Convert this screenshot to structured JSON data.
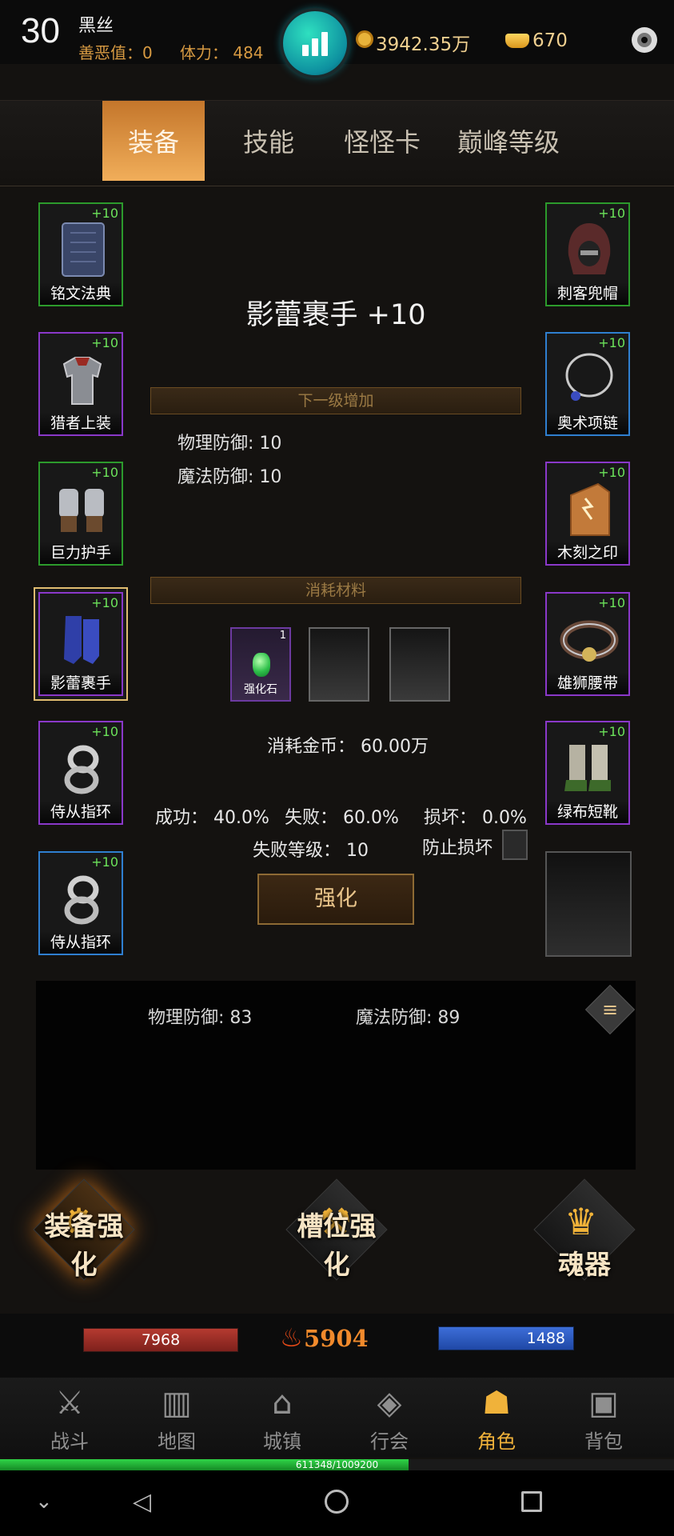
{
  "header": {
    "level": "30",
    "player_name": "黑丝",
    "karma": "善恶值：0",
    "stamina": "体力： 484",
    "gold": "3942.35万",
    "ingots": "670",
    "icons": {
      "stats": "bar-chart-icon",
      "coin": "coin-icon",
      "ingot": "ingot-icon",
      "settings": "gear-icon"
    }
  },
  "tabs": [
    {
      "label": "装备",
      "active": true
    },
    {
      "label": "技能",
      "active": false
    },
    {
      "label": "怪怪卡",
      "active": false
    },
    {
      "label": "巅峰等级",
      "active": false
    }
  ],
  "left_slots": [
    {
      "name": "铭文法典",
      "plus": "+10",
      "rarity": "green"
    },
    {
      "name": "猎者上装",
      "plus": "+10",
      "rarity": "purple"
    },
    {
      "name": "巨力护手",
      "plus": "+10",
      "rarity": "green"
    },
    {
      "name": "影蕾裹手",
      "plus": "+10",
      "rarity": "purple",
      "selected": true
    },
    {
      "name": "侍从指环",
      "plus": "+10",
      "rarity": "purple"
    },
    {
      "name": "侍从指环",
      "plus": "+10",
      "rarity": "blue"
    }
  ],
  "right_slots": [
    {
      "name": "刺客兜帽",
      "plus": "+10",
      "rarity": "green"
    },
    {
      "name": "奥术项链",
      "plus": "+10",
      "rarity": "blue"
    },
    {
      "name": "木刻之印",
      "plus": "+10",
      "rarity": "purple"
    },
    {
      "name": "雄狮腰带",
      "plus": "+10",
      "rarity": "purple"
    },
    {
      "name": "绿布短靴",
      "plus": "+10",
      "rarity": "purple"
    }
  ],
  "detail": {
    "item_title": "影蕾裹手 +10",
    "next_level_banner": "下一级增加",
    "next_stats": [
      "物理防御: 10",
      "魔法防御: 10"
    ],
    "materials_banner": "消耗材料",
    "material": {
      "name": "强化石",
      "count": "1"
    },
    "gold_cost": "消耗金币： 60.00万",
    "success": "成功： 40.0%",
    "failure": "失败： 60.0%",
    "break": "损坏： 0.0%",
    "fail_level": "失败等级： 10",
    "protect_label": "防止损坏",
    "protect_checked": false,
    "enhance_button": "强化"
  },
  "totals": {
    "physical": "物理防御: 83",
    "magic": "魔法防御: 89"
  },
  "features": [
    {
      "label": "装备强化",
      "icon": "equipment-enhance-icon",
      "active": true
    },
    {
      "label": "槽位强化",
      "icon": "slot-enhance-icon",
      "active": false
    },
    {
      "label": "魂器",
      "icon": "soul-artifact-icon",
      "active": false
    }
  ],
  "status": {
    "hp": "7968",
    "power": "5904",
    "mp": "1488"
  },
  "nav": [
    {
      "label": "战斗",
      "icon": "crossed-swords-icon"
    },
    {
      "label": "地图",
      "icon": "book-map-icon"
    },
    {
      "label": "城镇",
      "icon": "town-icon"
    },
    {
      "label": "行会",
      "icon": "guild-icon"
    },
    {
      "label": "角色",
      "icon": "character-icon",
      "active": true
    },
    {
      "label": "背包",
      "icon": "backpack-icon"
    }
  ],
  "xp": {
    "text": "611348/1009200",
    "fraction": 0.606
  },
  "colors": {
    "accent": "#f1ae5a",
    "gold_text": "#f0d090",
    "green_rarity": "#2c9a2c",
    "purple_rarity": "#8a38c9",
    "blue_rarity": "#2f7fd0"
  }
}
